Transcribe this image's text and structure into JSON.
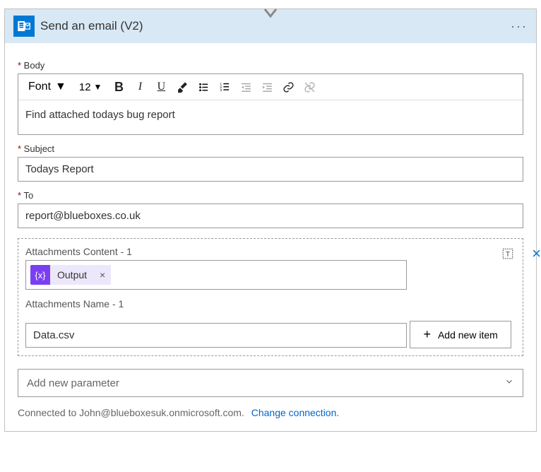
{
  "header": {
    "title": "Send an email (V2)"
  },
  "body": {
    "label": "Body",
    "font_label": "Font",
    "font_size": "12",
    "content": "Find attached todays bug report"
  },
  "subject": {
    "label": "Subject",
    "value": "Todays Report"
  },
  "to": {
    "label": "To",
    "value": "report@blueboxes.co.uk"
  },
  "attachments": {
    "content_label": "Attachments Content - 1",
    "token_label": "Output",
    "name_label": "Attachments Name - 1",
    "name_value": "Data.csv",
    "add_item": "Add new item"
  },
  "param_select": "Add new parameter",
  "footer": {
    "text": "Connected to John@blueboxesuk.onmicrosoft.com.",
    "link": "Change connection."
  }
}
